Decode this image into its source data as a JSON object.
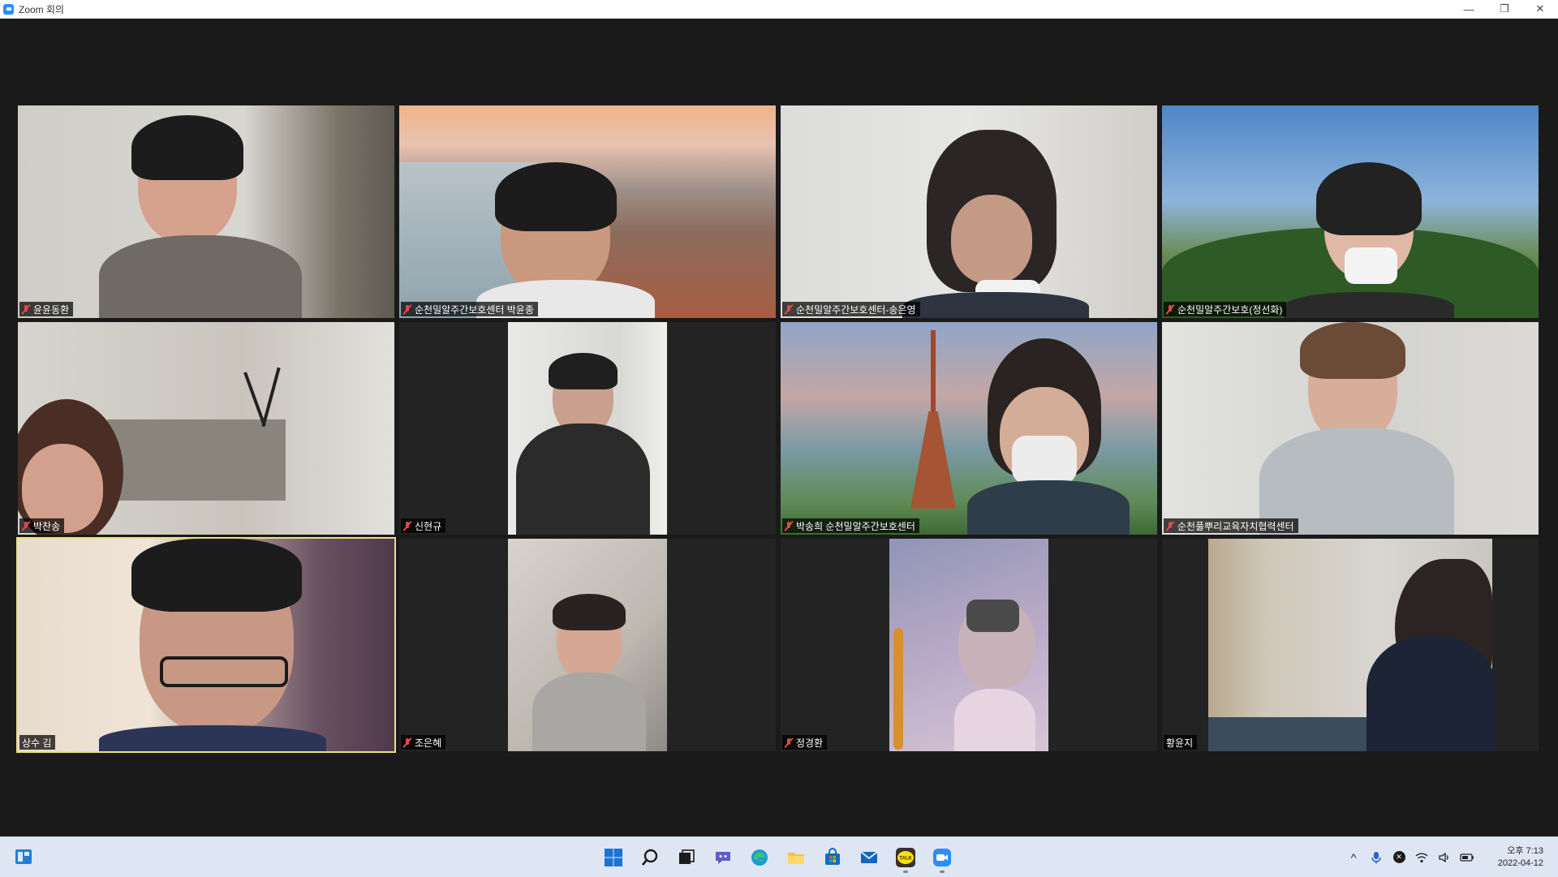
{
  "window": {
    "title": "Zoom 회의",
    "minimize": "—",
    "restore": "❐",
    "close": "✕"
  },
  "participants": [
    {
      "name": "윤윤동환",
      "muted": true
    },
    {
      "name": "순천밀알주간보호센터 박윤종",
      "muted": true
    },
    {
      "name": "순천밀알주간보호센터-송은영",
      "muted": true
    },
    {
      "name": "순천밀알주간보호(정선화)",
      "muted": true
    },
    {
      "name": "박찬송",
      "muted": true
    },
    {
      "name": "신현규",
      "muted": true
    },
    {
      "name": "박송희 순천밀알주간보호센터",
      "muted": true
    },
    {
      "name": "순천풀뿌리교육자치협력센터",
      "muted": true
    },
    {
      "name": "상수 김",
      "muted": false,
      "active_speaker": true
    },
    {
      "name": "조은혜",
      "muted": true
    },
    {
      "name": "정경환",
      "muted": true
    },
    {
      "name": "황윤지",
      "muted": false
    }
  ],
  "taskbar": {
    "icons": [
      "windows-start-icon",
      "search-icon",
      "task-view-icon",
      "teams-chat-icon",
      "edge-icon",
      "file-explorer-icon",
      "microsoft-store-icon",
      "mail-icon",
      "kakaotalk-icon",
      "zoom-icon"
    ],
    "kakao_label": "TALK",
    "tray": {
      "chevron": "^",
      "mic": "🎙",
      "x_badge": "✕",
      "wifi": "📶",
      "volume": "🔈",
      "battery": "🔋"
    },
    "clock_time": "오후 7:13",
    "clock_date": "2022-04-12"
  }
}
